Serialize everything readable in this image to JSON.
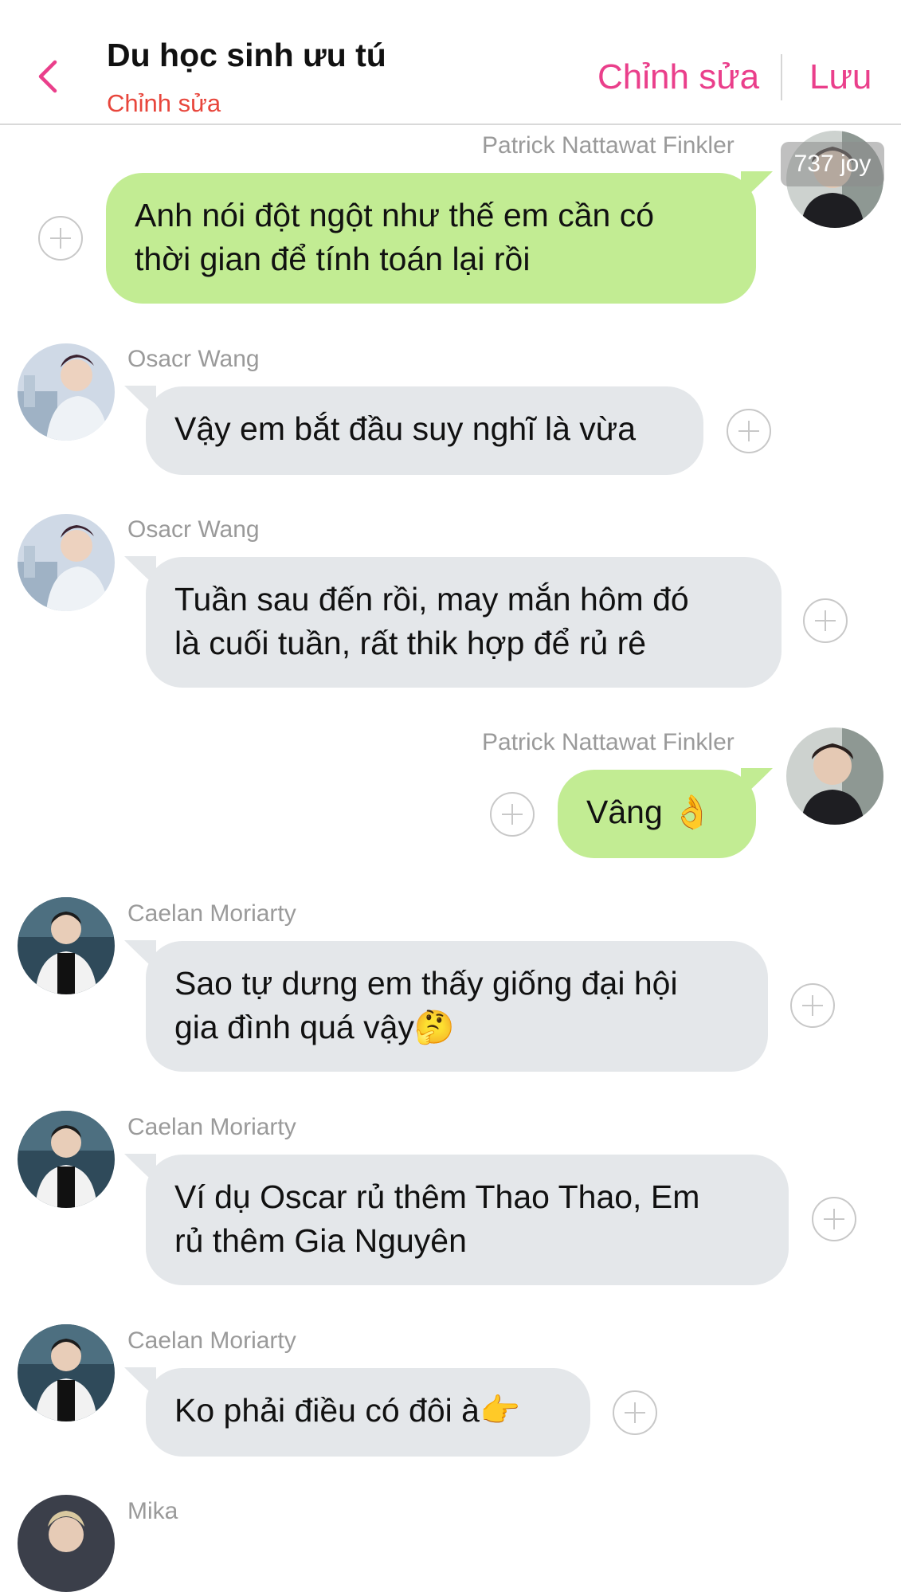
{
  "header": {
    "title": "Du học sinh ưu tú",
    "subtitle": "Chỉnh sửa",
    "edit_label": "Chỉnh sửa",
    "save_label": "Lưu",
    "back_icon": "chevron-left-icon",
    "accent_color": "#ea3f8b"
  },
  "messages": [
    {
      "sender": "Patrick Nattawat Finkler",
      "side": "out",
      "lines": [
        "Anh nói đột ngột như thế em cần có",
        "thời gian để tính toán lại rồi"
      ]
    },
    {
      "sender": "Osacr Wang",
      "side": "in",
      "lines": [
        "Vậy em bắt đầu suy nghĩ là vừa"
      ]
    },
    {
      "sender": "Osacr Wang",
      "side": "in",
      "lines": [
        "Tuần sau đến rồi, may mắn hôm đó",
        "là cuối tuần, rất thik hợp để rủ rê"
      ]
    },
    {
      "sender": "Patrick Nattawat Finkler",
      "side": "out",
      "lines": [
        "Vâng 👌"
      ]
    },
    {
      "sender": "Caelan Moriarty",
      "side": "in",
      "lines": [
        "Sao tự dưng em thấy giống đại hội",
        "gia đình quá vậy🤔"
      ]
    },
    {
      "sender": "Caelan Moriarty",
      "side": "in",
      "lines": [
        "Ví dụ Oscar rủ thêm Thao Thao, Em",
        "rủ thêm Gia Nguyên"
      ]
    },
    {
      "sender": "Caelan Moriarty",
      "side": "in",
      "lines": [
        "Ko phải điều có đôi à👉"
      ]
    },
    {
      "sender": "Mika",
      "side": "in",
      "lines": []
    }
  ],
  "watermark": "737 joy",
  "colors": {
    "incoming_bubble": "#e4e7ea",
    "outgoing_bubble": "#c2ec93",
    "name_text": "#9a9a9a",
    "subtitle": "#e8463c"
  }
}
